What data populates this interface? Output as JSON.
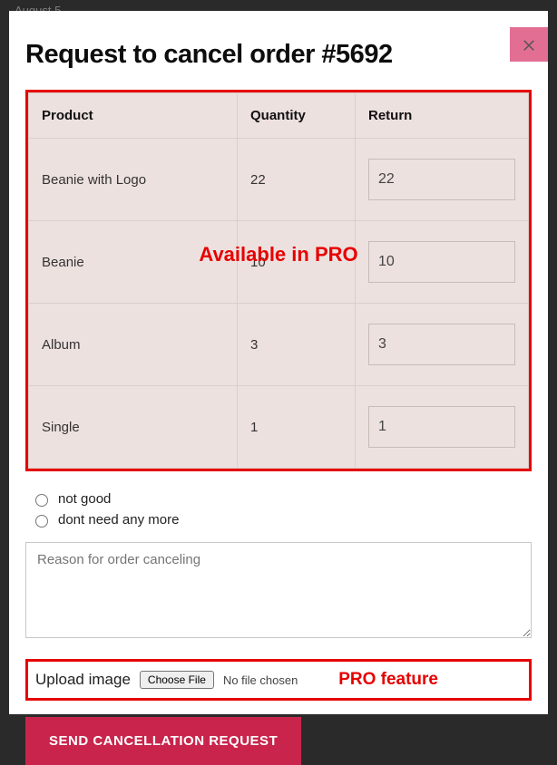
{
  "background_hint": "August 5",
  "title": "Request to cancel order #5692",
  "table": {
    "headers": {
      "product": "Product",
      "quantity": "Quantity",
      "return": "Return"
    },
    "rows": [
      {
        "product": "Beanie with Logo",
        "quantity": "22",
        "return": "22"
      },
      {
        "product": "Beanie",
        "quantity": "10",
        "return": "10"
      },
      {
        "product": "Album",
        "quantity": "3",
        "return": "3"
      },
      {
        "product": "Single",
        "quantity": "1",
        "return": "1"
      }
    ]
  },
  "overlay_pro_table": "Available in PRO",
  "reasons": [
    "not good",
    "dont need any more"
  ],
  "reason_placeholder": "Reason for order canceling",
  "upload": {
    "label": "Upload image",
    "button": "Choose File",
    "status": "No file chosen",
    "overlay": "PRO feature"
  },
  "send_button": "SEND CANCELLATION REQUEST"
}
